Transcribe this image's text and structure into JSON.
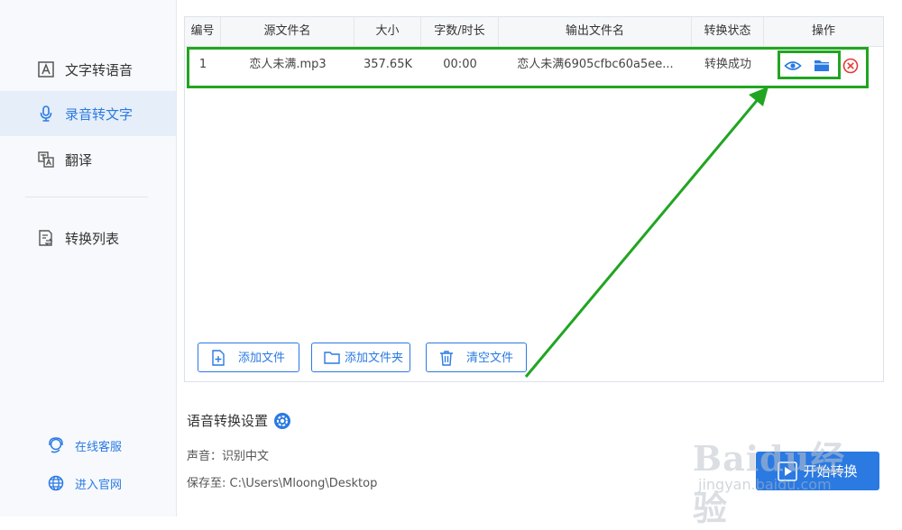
{
  "sidebar": {
    "items": [
      {
        "label": "文字转语音",
        "icon": "text-to-speech-icon",
        "active": false
      },
      {
        "label": "录音转文字",
        "icon": "microphone-icon",
        "active": true
      },
      {
        "label": "翻译",
        "icon": "translate-icon",
        "active": false
      },
      {
        "label": "转换列表",
        "icon": "conversion-list-icon",
        "active": false
      }
    ],
    "footer_links": [
      {
        "label": "在线客服",
        "icon": "customer-service-icon"
      },
      {
        "label": "进入官网",
        "icon": "globe-icon"
      }
    ]
  },
  "table": {
    "headers": [
      "编号",
      "源文件名",
      "大小",
      "字数/时长",
      "输出文件名",
      "转换状态",
      "操作"
    ],
    "rows": [
      {
        "index": "1",
        "source": "恋人未满.mp3",
        "size": "357.65K",
        "duration": "00:00",
        "output": "恋人未满6905cfbc60a5ee...",
        "status": "转换成功",
        "actions": [
          "eye-icon",
          "folder-icon",
          "close-circle-icon"
        ]
      }
    ]
  },
  "buttons": {
    "add_file": "添加文件",
    "add_folder": "添加文件夹",
    "clear_files": "清空文件",
    "start": "开始转换"
  },
  "settings": {
    "title": "语音转换设置",
    "voice": "声音：识别中文",
    "save_to": "保存至: C:\\Users\\Mloong\\Desktop"
  },
  "watermark": {
    "main": "Baidu经验",
    "sub": "jingyan.baidu.com"
  },
  "colors": {
    "accent": "#2a7ae2",
    "highlight": "#21a521",
    "danger": "#e53935"
  }
}
